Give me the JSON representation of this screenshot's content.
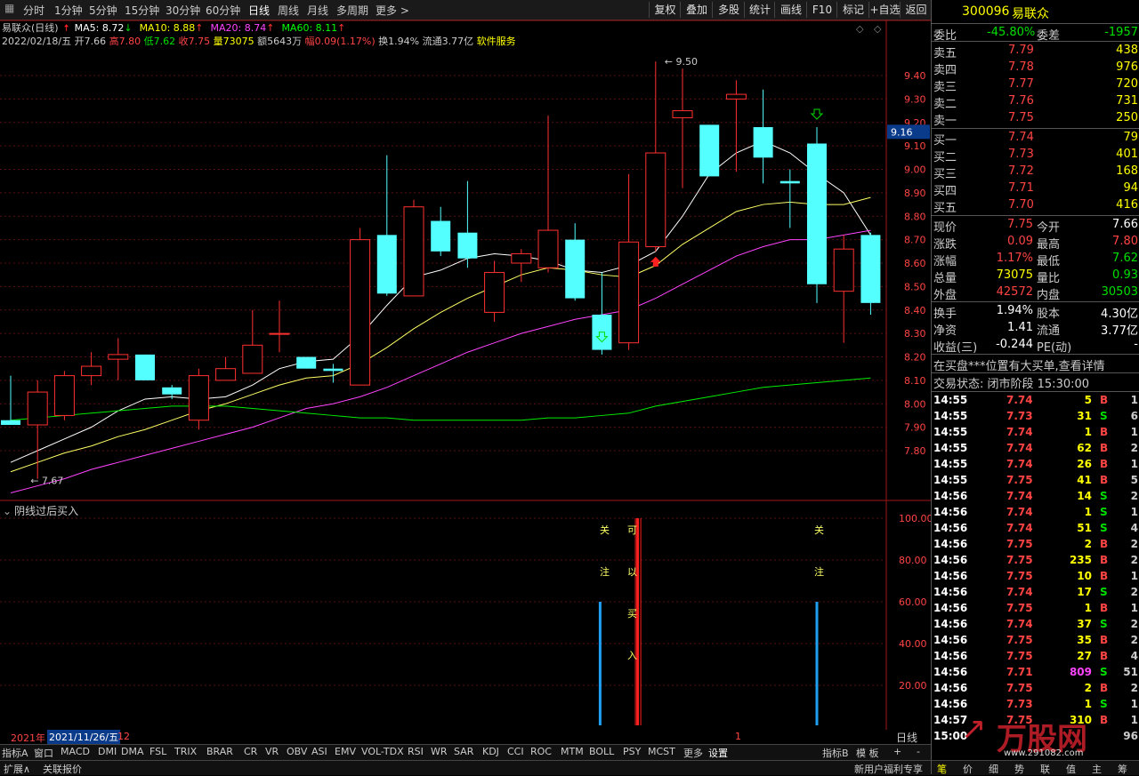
{
  "toolbar": {
    "periods": [
      "分时",
      "1分钟",
      "5分钟",
      "15分钟",
      "30分钟",
      "60分钟",
      "日线",
      "周线",
      "月线",
      "多周期",
      "更多 >"
    ],
    "active": "日线",
    "buttons": [
      "复权",
      "叠加",
      "多股",
      "统计",
      "画线",
      "F10",
      "标记",
      "+自选",
      "返回"
    ]
  },
  "stock": {
    "code": "300096",
    "name": "易联众",
    "title": "易联众(日线)",
    "ma": [
      {
        "label": "MA5: 8.72",
        "arrow": "↓",
        "color": "#ffffff",
        "arrow_color": "#00e000"
      },
      {
        "label": "MA10: 8.88",
        "arrow": "↑",
        "color": "#ffff00",
        "arrow_color": "#ff3333"
      },
      {
        "label": "MA20: 8.74",
        "arrow": "↑",
        "color": "#ff44ff",
        "arrow_color": "#ff3333"
      },
      {
        "label": "MA60: 8.11",
        "arrow": "↑",
        "color": "#00ff00",
        "arrow_color": "#ff3333"
      }
    ],
    "info_parts": [
      {
        "t": "2022/02/18/五 ",
        "c": "#cccccc"
      },
      {
        "t": "开7.66 ",
        "c": "#cccccc"
      },
      {
        "t": "高7.80 ",
        "c": "#ff4444"
      },
      {
        "t": "低7.62 ",
        "c": "#00e000"
      },
      {
        "t": "收7.75 ",
        "c": "#ff4444"
      },
      {
        "t": "量73075 ",
        "c": "#ffff00"
      },
      {
        "t": "额5643万 ",
        "c": "#cccccc"
      },
      {
        "t": "幅0.09(1.17%) ",
        "c": "#ff4444"
      },
      {
        "t": "换1.94% ",
        "c": "#cccccc"
      },
      {
        "t": "流通3.77亿 ",
        "c": "#cccccc"
      },
      {
        "t": "软件服务",
        "c": "#ffff00"
      }
    ]
  },
  "price_axis": {
    "labels": [
      "9.40",
      "9.30",
      "9.20",
      "9.10",
      "9.00",
      "8.90",
      "8.80",
      "8.70",
      "8.60",
      "8.50",
      "8.40",
      "8.30",
      "8.20",
      "8.10",
      "8.00",
      "7.90",
      "7.80"
    ],
    "current": "9.16"
  },
  "annotations": {
    "high": "9.50",
    "low": "7.67"
  },
  "indicator": {
    "title": "阴线过后买入",
    "axis": [
      "100.00",
      "80.00",
      "60.00",
      "40.00",
      "20.00"
    ],
    "label_guanzhu_1": [
      "关",
      "注"
    ],
    "label_keyimairu": [
      "可",
      "以",
      "买",
      "入"
    ],
    "label_guanzhu_2": [
      "关",
      "注"
    ]
  },
  "candles": [
    {
      "o": 7.93,
      "c": 7.91,
      "h": 8.12,
      "l": 7.91
    },
    {
      "o": 7.91,
      "c": 8.05,
      "h": 8.1,
      "l": 7.68
    },
    {
      "o": 7.95,
      "c": 8.12,
      "h": 8.14,
      "l": 7.93
    },
    {
      "o": 8.12,
      "c": 8.16,
      "h": 8.22,
      "l": 8.08
    },
    {
      "o": 8.19,
      "c": 8.21,
      "h": 8.28,
      "l": 8.1
    },
    {
      "o": 8.21,
      "c": 8.1,
      "h": 8.21,
      "l": 8.1
    },
    {
      "o": 8.07,
      "c": 8.04,
      "h": 8.08,
      "l": 8.02
    },
    {
      "o": 7.93,
      "c": 8.12,
      "h": 8.15,
      "l": 7.89
    },
    {
      "o": 8.1,
      "c": 8.15,
      "h": 8.2,
      "l": 8.1
    },
    {
      "o": 8.13,
      "c": 8.25,
      "h": 8.4,
      "l": 8.13
    },
    {
      "o": 8.3,
      "c": 8.3,
      "h": 8.44,
      "l": 8.22
    },
    {
      "o": 8.2,
      "c": 8.15,
      "h": 8.2,
      "l": 8.15
    },
    {
      "o": 8.15,
      "c": 8.14,
      "h": 8.17,
      "l": 8.09
    },
    {
      "o": 8.08,
      "c": 8.7,
      "h": 8.75,
      "l": 8.08
    },
    {
      "o": 8.72,
      "c": 8.47,
      "h": 9.06,
      "l": 8.46
    },
    {
      "o": 8.46,
      "c": 8.84,
      "h": 8.87,
      "l": 8.46
    },
    {
      "o": 8.78,
      "c": 8.65,
      "h": 8.84,
      "l": 8.63
    },
    {
      "o": 8.73,
      "c": 8.62,
      "h": 8.95,
      "l": 8.58
    },
    {
      "o": 8.39,
      "c": 8.56,
      "h": 8.61,
      "l": 8.35
    },
    {
      "o": 8.6,
      "c": 8.64,
      "h": 8.66,
      "l": 8.52
    },
    {
      "o": 8.58,
      "c": 8.74,
      "h": 9.23,
      "l": 8.56
    },
    {
      "o": 8.7,
      "c": 8.45,
      "h": 8.77,
      "l": 8.44
    },
    {
      "o": 8.38,
      "c": 8.23,
      "h": 8.56,
      "l": 8.21
    },
    {
      "o": 8.26,
      "c": 8.69,
      "h": 8.98,
      "l": 8.23
    },
    {
      "o": 8.67,
      "c": 9.07,
      "h": 9.46,
      "l": 8.65
    },
    {
      "o": 9.22,
      "c": 9.25,
      "h": 9.43,
      "l": 8.92
    },
    {
      "o": 9.19,
      "c": 8.97,
      "h": 9.19,
      "l": 8.97
    },
    {
      "o": 9.3,
      "c": 9.32,
      "h": 9.38,
      "l": 8.99
    },
    {
      "o": 9.18,
      "c": 9.05,
      "h": 9.34,
      "l": 8.94
    },
    {
      "o": 8.95,
      "c": 8.94,
      "h": 9.0,
      "l": 8.75
    },
    {
      "o": 9.11,
      "c": 8.51,
      "h": 9.18,
      "l": 8.43
    },
    {
      "o": 8.48,
      "c": 8.66,
      "h": 8.72,
      "l": 8.26
    },
    {
      "o": 8.72,
      "c": 8.43,
      "h": 8.73,
      "l": 8.38
    }
  ],
  "ma_lines": {
    "ma5": [
      7.75,
      7.8,
      7.85,
      7.9,
      7.97,
      8.02,
      8.03,
      8.02,
      8.03,
      8.08,
      8.15,
      8.18,
      8.19,
      8.29,
      8.42,
      8.54,
      8.57,
      8.62,
      8.64,
      8.63,
      8.61,
      8.57,
      8.56,
      8.59,
      8.65,
      8.8,
      8.98,
      9.07,
      9.12,
      9.07,
      8.98,
      8.9,
      8.72
    ],
    "ma10": [
      7.71,
      7.75,
      7.79,
      7.82,
      7.86,
      7.89,
      7.93,
      7.97,
      8.0,
      8.04,
      8.08,
      8.11,
      8.12,
      8.17,
      8.24,
      8.32,
      8.39,
      8.45,
      8.5,
      8.55,
      8.58,
      8.57,
      8.55,
      8.54,
      8.59,
      8.68,
      8.75,
      8.82,
      8.85,
      8.86,
      8.85,
      8.85,
      8.88
    ],
    "ma20": [
      7.62,
      7.65,
      7.68,
      7.72,
      7.75,
      7.78,
      7.81,
      7.84,
      7.87,
      7.9,
      7.94,
      7.98,
      8.0,
      8.03,
      8.07,
      8.12,
      8.17,
      8.22,
      8.26,
      8.3,
      8.33,
      8.36,
      8.38,
      8.4,
      8.45,
      8.51,
      8.57,
      8.63,
      8.67,
      8.7,
      8.7,
      8.72,
      8.74
    ],
    "ma60": [
      7.93,
      7.94,
      7.95,
      7.96,
      7.97,
      7.98,
      7.99,
      7.99,
      7.99,
      7.98,
      7.97,
      7.96,
      7.95,
      7.94,
      7.94,
      7.93,
      7.93,
      7.93,
      7.93,
      7.93,
      7.94,
      7.94,
      7.95,
      7.96,
      7.99,
      8.01,
      8.03,
      8.05,
      8.07,
      8.08,
      8.09,
      8.1,
      8.11
    ]
  },
  "signals": {
    "bars": [
      {
        "idx": 22,
        "v": 60,
        "color": "#1e9ff2"
      },
      {
        "idx": 23,
        "v": 100,
        "color": "#ff2020"
      },
      {
        "idx": 30,
        "v": 60,
        "color": "#1e9ff2"
      }
    ]
  },
  "dates": {
    "year": "2021年",
    "date": "2021/11/26/五",
    "month": "12",
    "mark": "1",
    "period": "日线"
  },
  "indicator_tabs": [
    "指标A",
    "窗口",
    "MACD",
    "DMI",
    "DMA",
    "FSL",
    "TRIX",
    "BRAR",
    "CR",
    "VR",
    "OBV",
    "ASI",
    "EMV",
    "VOL-TDX",
    "RSI",
    "WR",
    "SAR",
    "KDJ",
    "CCI",
    "ROC",
    "MTM",
    "BOLL",
    "PSY",
    "MCST",
    "更多",
    "设置"
  ],
  "indicator_tabs_right": [
    "指标B",
    "模 板",
    "+",
    "-"
  ],
  "bottom": {
    "left": [
      "扩展∧",
      "关联报价"
    ],
    "right": "新用户福利专享"
  },
  "quote": {
    "weibi": {
      "label": "委比",
      "value": "-45.80%",
      "label2": "委差",
      "value2": "-1957"
    },
    "asks": [
      {
        "label": "卖五",
        "price": "7.79",
        "vol": "438"
      },
      {
        "label": "卖四",
        "price": "7.78",
        "vol": "976"
      },
      {
        "label": "卖三",
        "price": "7.77",
        "vol": "720"
      },
      {
        "label": "卖二",
        "price": "7.76",
        "vol": "731"
      },
      {
        "label": "卖一",
        "price": "7.75",
        "vol": "250"
      }
    ],
    "bids": [
      {
        "label": "买一",
        "price": "7.74",
        "vol": "79"
      },
      {
        "label": "买二",
        "price": "7.73",
        "vol": "401"
      },
      {
        "label": "买三",
        "price": "7.72",
        "vol": "168"
      },
      {
        "label": "买四",
        "price": "7.71",
        "vol": "94"
      },
      {
        "label": "买五",
        "price": "7.70",
        "vol": "416"
      }
    ],
    "stats": [
      {
        "l1": "现价",
        "v1": "7.75",
        "c1": "#ff4444",
        "l2": "今开",
        "v2": "7.66",
        "c2": "#ffffff"
      },
      {
        "l1": "涨跌",
        "v1": "0.09",
        "c1": "#ff4444",
        "l2": "最高",
        "v2": "7.80",
        "c2": "#ff4444"
      },
      {
        "l1": "涨幅",
        "v1": "1.17%",
        "c1": "#ff4444",
        "l2": "最低",
        "v2": "7.62",
        "c2": "#00e000"
      },
      {
        "l1": "总量",
        "v1": "73075",
        "c1": "#ffff00",
        "l2": "量比",
        "v2": "0.93",
        "c2": "#00e000"
      },
      {
        "l1": "外盘",
        "v1": "42572",
        "c1": "#ff4444",
        "l2": "内盘",
        "v2": "30503",
        "c2": "#00e000"
      }
    ],
    "stats2": [
      {
        "l1": "换手",
        "v1": "1.94%",
        "l2": "股本",
        "v2": "4.30亿"
      },
      {
        "l1": "净资",
        "v1": "1.41",
        "l2": "流通",
        "v2": "3.77亿"
      },
      {
        "l1": "收益(三)",
        "v1": "-0.244",
        "l2": "PE(动)",
        "v2": "-"
      }
    ],
    "notice": "在买盘***位置有大买单,查看详情",
    "status": "交易状态: 闭市阶段 15:30:00"
  },
  "ticks": [
    {
      "t": "14:55",
      "p": "7.74",
      "v": "5",
      "s": "B",
      "n": "1"
    },
    {
      "t": "14:55",
      "p": "7.73",
      "v": "31",
      "s": "S",
      "n": "6"
    },
    {
      "t": "14:55",
      "p": "7.74",
      "v": "1",
      "s": "B",
      "n": "1"
    },
    {
      "t": "14:55",
      "p": "7.74",
      "v": "62",
      "s": "B",
      "n": "2"
    },
    {
      "t": "14:55",
      "p": "7.74",
      "v": "26",
      "s": "B",
      "n": "1"
    },
    {
      "t": "14:55",
      "p": "7.75",
      "v": "41",
      "s": "B",
      "n": "5"
    },
    {
      "t": "14:56",
      "p": "7.74",
      "v": "14",
      "s": "S",
      "n": "2"
    },
    {
      "t": "14:56",
      "p": "7.74",
      "v": "1",
      "s": "S",
      "n": "1"
    },
    {
      "t": "14:56",
      "p": "7.74",
      "v": "51",
      "s": "S",
      "n": "4"
    },
    {
      "t": "14:56",
      "p": "7.75",
      "v": "2",
      "s": "B",
      "n": "2"
    },
    {
      "t": "14:56",
      "p": "7.75",
      "v": "235",
      "s": "B",
      "n": "2"
    },
    {
      "t": "14:56",
      "p": "7.75",
      "v": "10",
      "s": "B",
      "n": "1"
    },
    {
      "t": "14:56",
      "p": "7.74",
      "v": "17",
      "s": "S",
      "n": "2"
    },
    {
      "t": "14:56",
      "p": "7.75",
      "v": "1",
      "s": "B",
      "n": "1"
    },
    {
      "t": "14:56",
      "p": "7.74",
      "v": "37",
      "s": "S",
      "n": "2"
    },
    {
      "t": "14:56",
      "p": "7.75",
      "v": "35",
      "s": "B",
      "n": "2"
    },
    {
      "t": "14:56",
      "p": "7.75",
      "v": "27",
      "s": "B",
      "n": "4"
    },
    {
      "t": "14:56",
      "p": "7.71",
      "v": "809",
      "s": "S",
      "n": "51"
    },
    {
      "t": "14:56",
      "p": "7.75",
      "v": "2",
      "s": "B",
      "n": "2"
    },
    {
      "t": "14:56",
      "p": "7.73",
      "v": "1",
      "s": "S",
      "n": "1"
    },
    {
      "t": "14:57",
      "p": "7.75",
      "v": "310",
      "s": "B",
      "n": "1"
    },
    {
      "t": "15:00",
      "p": "",
      "v": "",
      "s": "",
      "n": "96"
    }
  ],
  "right_bottom_tabs": [
    "笔",
    "价",
    "细",
    "势",
    "联",
    "值",
    "主",
    "筹"
  ],
  "watermark": {
    "text": "万股网",
    "url": "www.291082.com"
  }
}
